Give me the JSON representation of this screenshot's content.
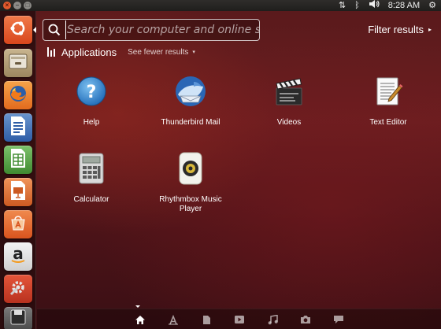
{
  "top_panel": {
    "window_buttons": [
      "close",
      "minimize",
      "maximize"
    ],
    "indicators": [
      {
        "icon": "network-arrows-icon",
        "glyph": "⇅"
      },
      {
        "icon": "bluetooth-icon",
        "glyph": "ᛒ"
      },
      {
        "icon": "volume-icon",
        "glyph": "🔊"
      }
    ],
    "clock": "8:28 AM",
    "settings_glyph": "⚙"
  },
  "launcher": {
    "items": [
      {
        "name": "dash-home",
        "icon": "ubuntu-logo-icon"
      },
      {
        "name": "files",
        "icon": "file-cabinet-icon"
      },
      {
        "name": "firefox",
        "icon": "firefox-icon"
      },
      {
        "name": "writer",
        "icon": "libreoffice-writer-icon"
      },
      {
        "name": "calc",
        "icon": "libreoffice-calc-icon"
      },
      {
        "name": "impress",
        "icon": "libreoffice-impress-icon"
      },
      {
        "name": "software-center",
        "icon": "software-center-icon"
      },
      {
        "name": "amazon",
        "icon": "amazon-icon",
        "glyph": "a"
      },
      {
        "name": "system-settings",
        "icon": "settings-tools-icon"
      },
      {
        "name": "floppy",
        "icon": "floppy-disk-icon"
      }
    ]
  },
  "search": {
    "placeholder": "Search your computer and online sources",
    "value": ""
  },
  "filter": {
    "label": "Filter results",
    "arrow": "▸"
  },
  "category": {
    "title": "Applications",
    "toggle_label": "See fewer results",
    "toggle_arrow": "▾"
  },
  "apps": [
    {
      "label": "Help",
      "icon": "help-icon"
    },
    {
      "label": "Thunderbird Mail",
      "icon": "thunderbird-icon"
    },
    {
      "label": "Videos",
      "icon": "videos-clapperboard-icon"
    },
    {
      "label": "Text Editor",
      "icon": "text-editor-icon"
    },
    {
      "label": "Calculator",
      "icon": "calculator-icon"
    },
    {
      "label": "Rhythmbox Music Player",
      "icon": "rhythmbox-icon"
    }
  ],
  "lenses": [
    {
      "name": "home",
      "icon": "home-icon",
      "active": true
    },
    {
      "name": "applications",
      "icon": "applications-lens-icon"
    },
    {
      "name": "files",
      "icon": "files-lens-icon"
    },
    {
      "name": "video",
      "icon": "video-lens-icon"
    },
    {
      "name": "music",
      "icon": "music-lens-icon"
    },
    {
      "name": "photos",
      "icon": "photos-lens-icon"
    },
    {
      "name": "social",
      "icon": "social-lens-icon"
    }
  ],
  "colors": {
    "accent_orange": "#e95420",
    "dash_background": "#5a1a1c"
  }
}
